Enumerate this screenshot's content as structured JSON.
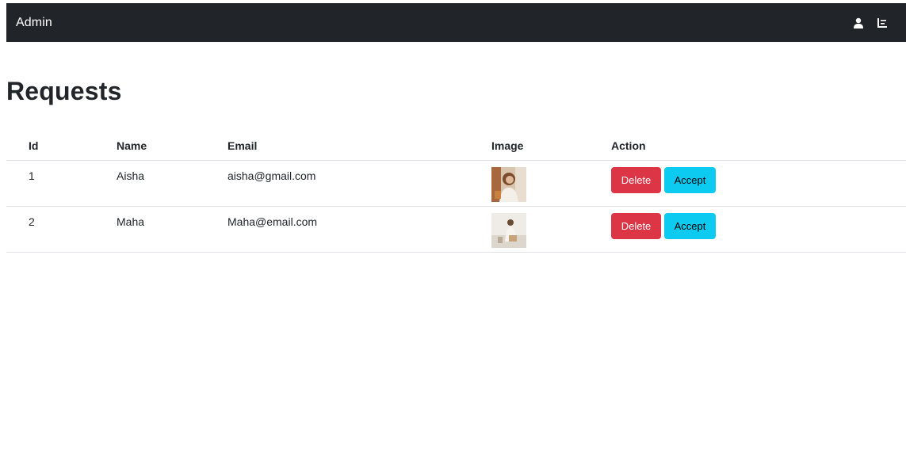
{
  "navbar": {
    "brand": "Admin",
    "icons": [
      "user-icon",
      "list-icon"
    ]
  },
  "page": {
    "title": "Requests"
  },
  "table": {
    "headers": {
      "id": "Id",
      "name": "Name",
      "email": "Email",
      "image": "Image",
      "action": "Action"
    },
    "rows": [
      {
        "id": "1",
        "name": "Aisha",
        "email": "aisha@gmail.com",
        "image_icon": "profile-photo",
        "delete_label": "Delete",
        "accept_label": "Accept"
      },
      {
        "id": "2",
        "name": "Maha",
        "email": "Maha@email.com",
        "image_icon": "profile-photo",
        "delete_label": "Delete",
        "accept_label": "Accept"
      }
    ]
  },
  "colors": {
    "navbar_bg": "#212529",
    "delete": "#dc3545",
    "accept": "#0dcaf0"
  }
}
